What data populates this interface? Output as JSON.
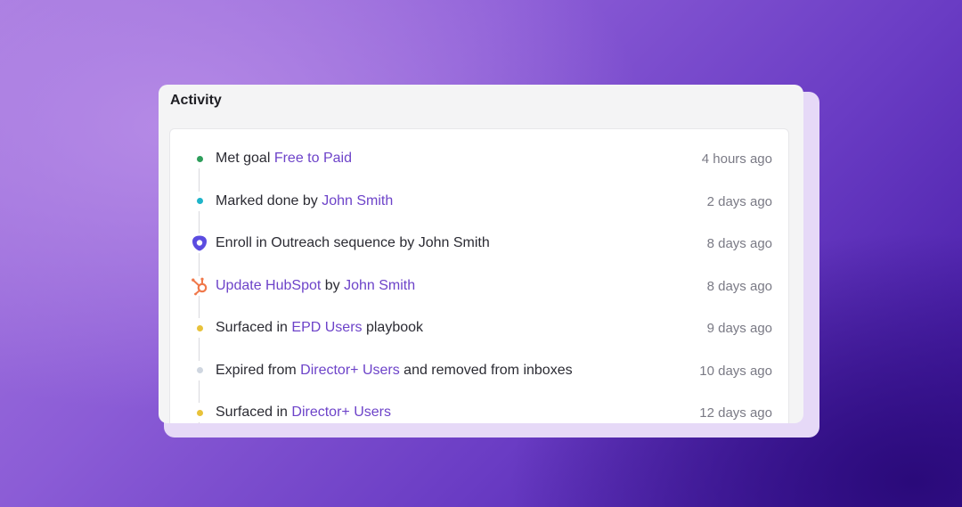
{
  "panel": {
    "title": "Activity"
  },
  "activities": [
    {
      "marker": "green-dot-icon",
      "color": "#2e9e5b",
      "parts": [
        {
          "text": "Met goal ",
          "link": false
        },
        {
          "text": "Free to Paid",
          "link": true
        }
      ],
      "time": "4 hours ago"
    },
    {
      "marker": "teal-dot-icon",
      "color": "#1fb4c9",
      "parts": [
        {
          "text": "Marked done by ",
          "link": false
        },
        {
          "text": "John Smith",
          "link": true
        }
      ],
      "time": "2 days ago"
    },
    {
      "marker": "outreach-icon",
      "color": "#5b4ce0",
      "parts": [
        {
          "text": "Enroll in Outreach sequence by John Smith",
          "link": false
        }
      ],
      "time": "8 days ago"
    },
    {
      "marker": "hubspot-icon",
      "color": "#f0784a",
      "parts": [
        {
          "text": "Update HubSpot",
          "link": true
        },
        {
          "text": " by ",
          "link": false
        },
        {
          "text": "John Smith",
          "link": true
        }
      ],
      "time": "8 days ago"
    },
    {
      "marker": "yellow-dot-icon",
      "color": "#e8c23a",
      "parts": [
        {
          "text": "Surfaced in ",
          "link": false
        },
        {
          "text": "EPD Users",
          "link": true
        },
        {
          "text": " playbook",
          "link": false
        }
      ],
      "time": "9 days ago"
    },
    {
      "marker": "gray-dot-icon",
      "color": "#cfd6e0",
      "parts": [
        {
          "text": "Expired from ",
          "link": false
        },
        {
          "text": "Director+ Users",
          "link": true
        },
        {
          "text": " and removed from inboxes",
          "link": false
        }
      ],
      "time": "10 days ago"
    },
    {
      "marker": "yellow-dot-icon",
      "color": "#e8c23a",
      "parts": [
        {
          "text": "Surfaced in ",
          "link": false
        },
        {
          "text": "Director+ Users",
          "link": true
        }
      ],
      "time": "12 days ago"
    }
  ]
}
